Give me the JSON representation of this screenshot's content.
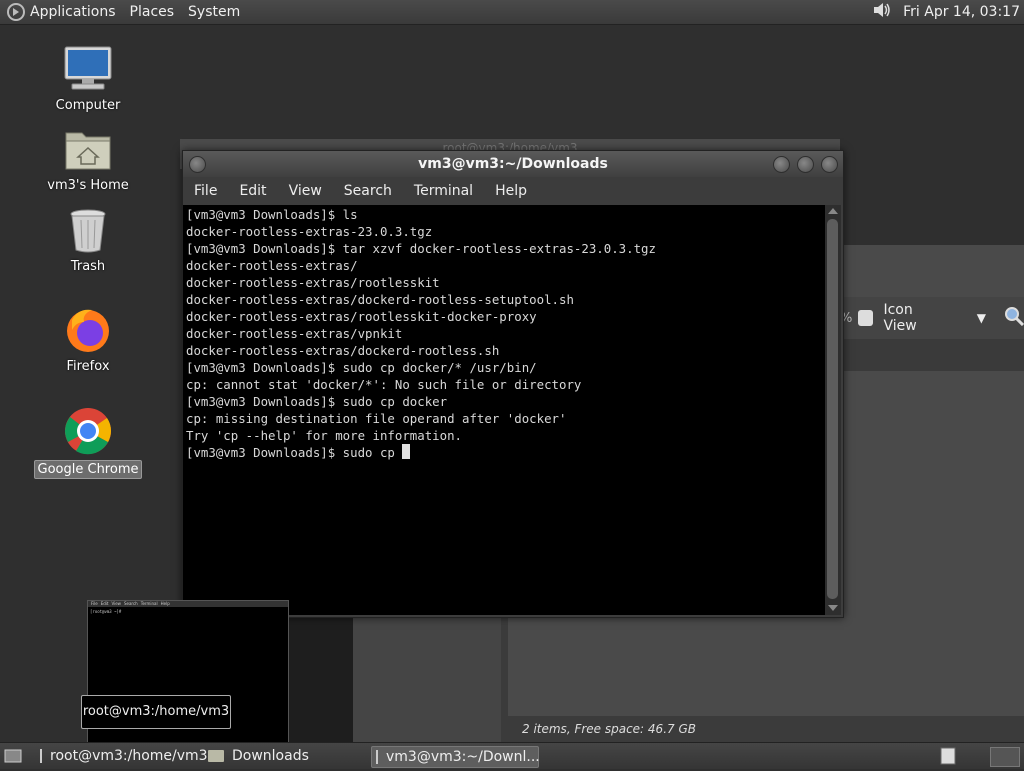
{
  "top_panel": {
    "menus": [
      "Applications",
      "Places",
      "System"
    ],
    "clock": "Fri Apr 14, 03:17"
  },
  "desktop_icons": [
    {
      "label": "Computer",
      "icon": "computer-icon"
    },
    {
      "label": "vm3's Home",
      "icon": "home-folder-icon"
    },
    {
      "label": "Trash",
      "icon": "trash-icon"
    },
    {
      "label": "Firefox",
      "icon": "firefox-icon"
    },
    {
      "label": "Google Chrome",
      "icon": "chrome-icon"
    }
  ],
  "background_terminal": {
    "title": "root@vm3:/home/vm3",
    "preview_menu": [
      "File",
      "Edit",
      "View",
      "Search",
      "Terminal",
      "Help"
    ],
    "preview_prompt": "[root@vm3 ~]#"
  },
  "file_manager": {
    "view_mode": "Icon View",
    "zoom_suffix": "%",
    "status": "2 items, Free space: 46.7 GB"
  },
  "terminal": {
    "title": "vm3@vm3:~/Downloads",
    "menu": [
      "File",
      "Edit",
      "View",
      "Search",
      "Terminal",
      "Help"
    ],
    "lines": [
      "[vm3@vm3 Downloads]$ ls",
      "docker-rootless-extras-23.0.3.tgz",
      "[vm3@vm3 Downloads]$ tar xzvf docker-rootless-extras-23.0.3.tgz",
      "docker-rootless-extras/",
      "docker-rootless-extras/rootlesskit",
      "docker-rootless-extras/dockerd-rootless-setuptool.sh",
      "docker-rootless-extras/rootlesskit-docker-proxy",
      "docker-rootless-extras/vpnkit",
      "docker-rootless-extras/dockerd-rootless.sh",
      "[vm3@vm3 Downloads]$ sudo cp docker/* /usr/bin/",
      "cp: cannot stat 'docker/*': No such file or directory",
      "[vm3@vm3 Downloads]$ sudo cp docker",
      "cp: missing destination file operand after 'docker'",
      "Try 'cp --help' for more information."
    ],
    "current_input": "[vm3@vm3 Downloads]$ sudo cp "
  },
  "tooltip": "root@vm3:/home/vm3",
  "taskbar": [
    {
      "label": "root@vm3:/home/vm3",
      "icon": "terminal-icon",
      "active": false
    },
    {
      "label": "Downloads",
      "icon": "folder-icon",
      "active": false
    },
    {
      "label": "vm3@vm3:~/Downl...",
      "icon": "terminal-icon",
      "active": true
    }
  ]
}
